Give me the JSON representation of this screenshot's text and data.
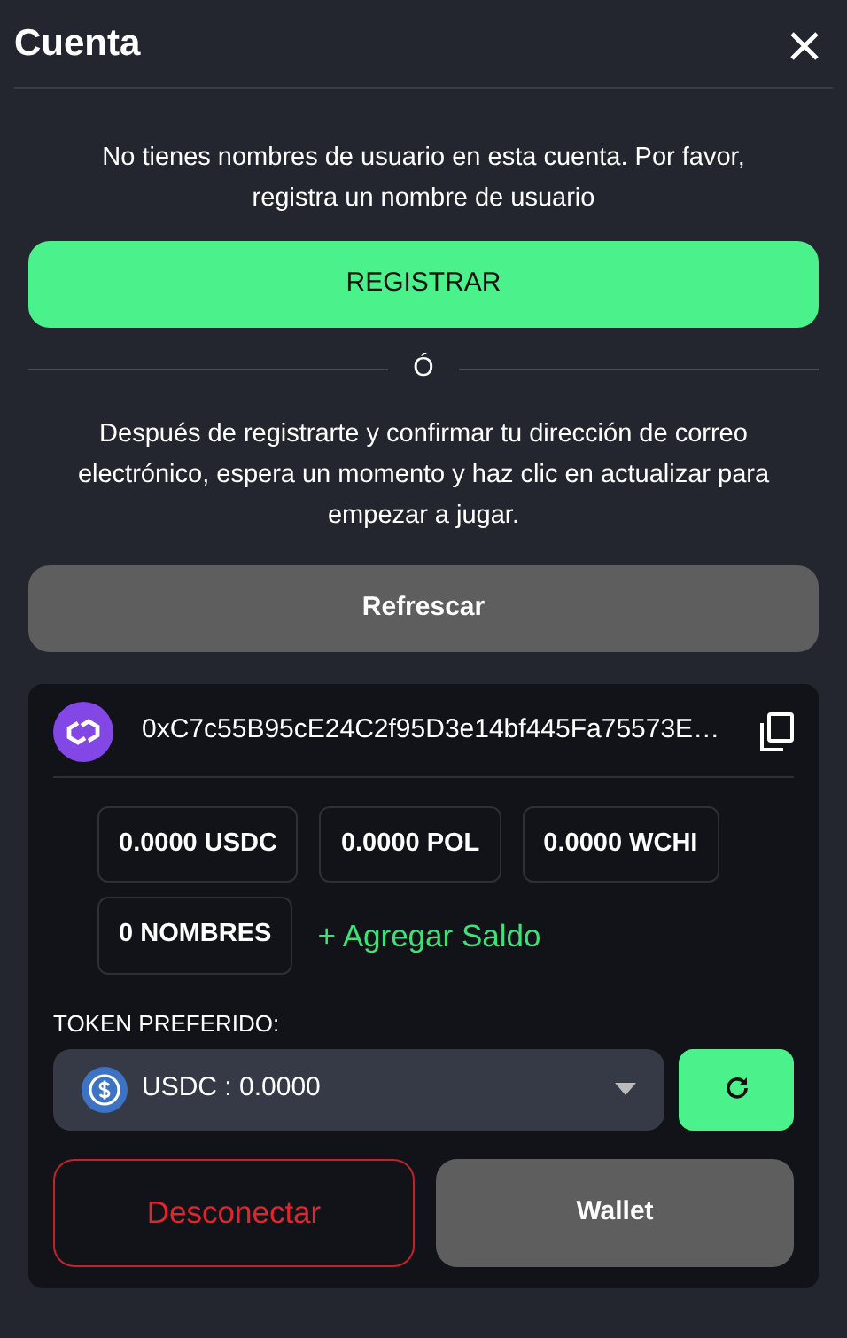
{
  "title": "Cuenta",
  "notice": "No tienes nombres de usuario en esta cuenta. Por favor, registra un nombre de usuario",
  "register_button": "REGISTRAR",
  "separator": "Ó",
  "instructions": "Después de registrarte y confirmar tu dirección de correo electrónico, espera un momento y haz clic en actualizar para empezar a jugar.",
  "refresh_button": "Refrescar",
  "wallet": {
    "address": "0xC7c55B95cE24C2f95D3e14bf445Fa75573E…",
    "balances": [
      {
        "text": "0.0000 USDC"
      },
      {
        "text": "0.0000 POL"
      },
      {
        "text": "0.0000 WCHI"
      },
      {
        "text": "0 NOMBRES"
      }
    ],
    "add_funds": "+ Agregar Saldo",
    "token_label": "TOKEN PREFERIDO:",
    "token_value": "USDC : 0.0000",
    "disconnect_button": "Desconectar",
    "wallet_button": "Wallet"
  }
}
